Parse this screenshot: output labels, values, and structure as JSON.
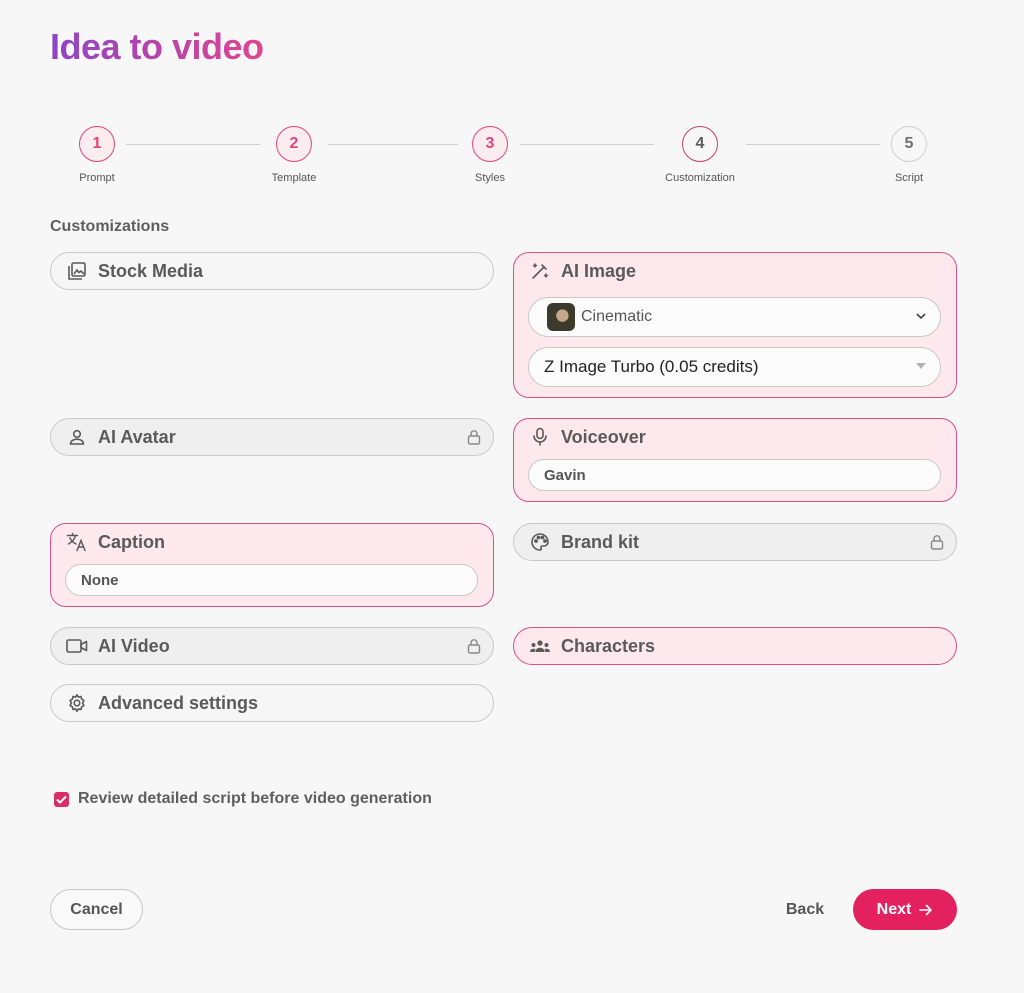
{
  "title": "Idea to video",
  "stepper": {
    "steps": [
      {
        "number": "1",
        "label": "Prompt"
      },
      {
        "number": "2",
        "label": "Template"
      },
      {
        "number": "3",
        "label": "Styles"
      },
      {
        "number": "4",
        "label": "Customization"
      },
      {
        "number": "5",
        "label": "Script"
      }
    ]
  },
  "section_label": "Customizations",
  "cards": {
    "stock_media": {
      "label": "Stock Media"
    },
    "ai_image": {
      "label": "AI Image",
      "style_value": "Cinematic",
      "model_value": "Z Image Turbo (0.05 credits)"
    },
    "ai_avatar": {
      "label": "AI Avatar",
      "locked": true
    },
    "voiceover": {
      "label": "Voiceover",
      "value": "Gavin"
    },
    "caption": {
      "label": "Caption",
      "value": "None"
    },
    "brand_kit": {
      "label": "Brand kit",
      "locked": true
    },
    "ai_video": {
      "label": "AI Video",
      "locked": true
    },
    "characters": {
      "label": "Characters"
    },
    "advanced": {
      "label": "Advanced settings"
    }
  },
  "review_checkbox": {
    "label": "Review detailed script before video generation",
    "checked": true
  },
  "footer": {
    "cancel": "Cancel",
    "back": "Back",
    "next": "Next"
  },
  "colors": {
    "accent": "#e4215f",
    "card_pink_bg": "#fde8ee",
    "card_pink_border": "#d6508a"
  }
}
